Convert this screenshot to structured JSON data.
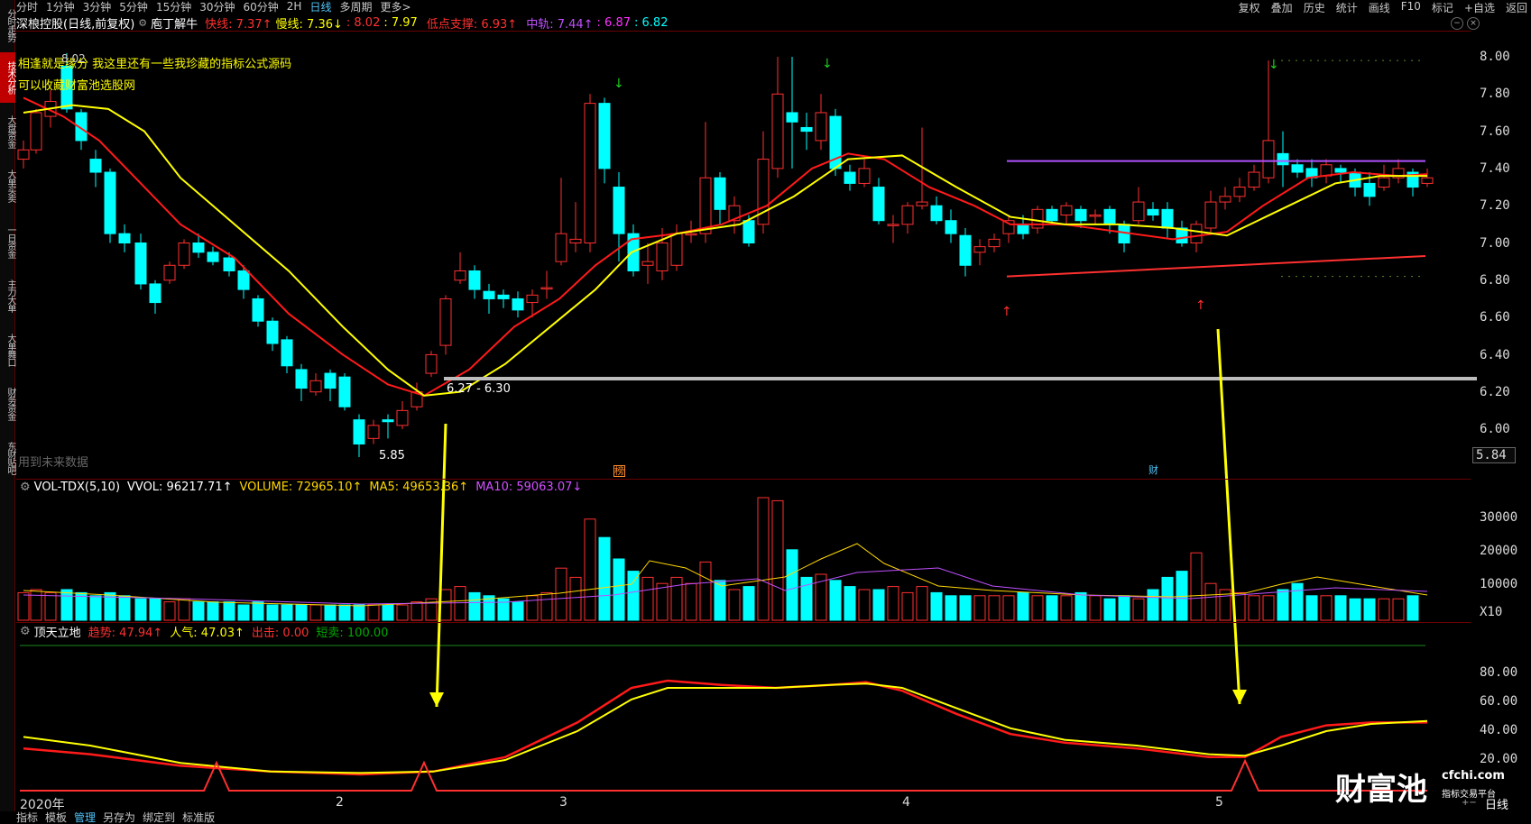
{
  "sidebar": {
    "items": [
      {
        "label": "分时走势",
        "active": false
      },
      {
        "label": "技术分析",
        "active": true
      },
      {
        "label": "大盘资金",
        "active": false
      },
      {
        "label": "大单买卖",
        "active": false
      },
      {
        "label": "一日资金",
        "active": false
      },
      {
        "label": "主力大单",
        "active": false
      },
      {
        "label": "大单舞口",
        "active": false
      },
      {
        "label": "财务资金",
        "active": false
      },
      {
        "label": "东财贴吧",
        "active": false
      }
    ]
  },
  "toolbar": {
    "periods": [
      "分时",
      "1分钟",
      "3分钟",
      "5分钟",
      "15分钟",
      "30分钟",
      "60分钟",
      "2H",
      "日线",
      "多周期",
      "更多>"
    ],
    "active_period": "日线",
    "right": [
      "复权",
      "叠加",
      "历史",
      "统计",
      "画线",
      "F10",
      "标记",
      "+自选",
      "返回"
    ]
  },
  "header": {
    "stock": "深桹控股(日线,前复权)",
    "indicator": "庖丁解牛",
    "fast": "快线: 7.37↑",
    "slow": "慢线: 7.36↓",
    "r1": ": 8.02",
    "r2": ": 7.97",
    "support": "低点支撑: 6.93↑",
    "mid": "中轨: 7.44↑",
    "m1": ": 6.87",
    "m2": ": 6.82"
  },
  "annotations": {
    "line1": "相逢就是缘分  我这里还有一些我珍藏的指标公式源码",
    "line2": "可以收藏财富池选股网",
    "price_high": "8.02",
    "zone": "6.27 - 6.30",
    "low": "5.85",
    "future_data": "用到未来数据",
    "marker_bang": "榜",
    "marker_cai": "财"
  },
  "price_axis": {
    "labels": [
      "8.00",
      "7.80",
      "7.60",
      "7.40",
      "7.20",
      "7.00",
      "6.80",
      "6.60",
      "6.40",
      "6.20",
      "6.00"
    ],
    "current": "5.84"
  },
  "volume": {
    "title": "VOL-TDX(5,10)",
    "vvol": "VVOL: 96217.71↑",
    "volume": "VOLUME: 72965.10↑",
    "ma5": "MA5: 49653.36↑",
    "ma10": "MA10: 59063.07↓",
    "axis": [
      "30000",
      "20000",
      "10000"
    ],
    "unit": "X10"
  },
  "indicator2": {
    "title": "顶天立地",
    "trend": "趋势: 47.94↑",
    "pop": "人气: 47.03↑",
    "exit": "出击: 0.00",
    "short": "短卖: 100.00",
    "axis": [
      "80.00",
      "60.00",
      "40.00",
      "20.00"
    ]
  },
  "x_axis": [
    "2020年",
    "2",
    "3",
    "4",
    "5"
  ],
  "bottom_tabs": [
    "指标",
    "模板",
    "管理",
    "另存为",
    "绑定到",
    "标准版"
  ],
  "bottom_active": "管理",
  "bottom_right": "日线",
  "watermark": {
    "brand": "财富池",
    "site": "cfchi.com",
    "sub": "指标交易平台"
  },
  "colors": {
    "up": "#ff3030",
    "down": "#00ffff",
    "fast": "#ff1a1a",
    "slow": "#ffff00",
    "purple": "#b050ff"
  }
}
